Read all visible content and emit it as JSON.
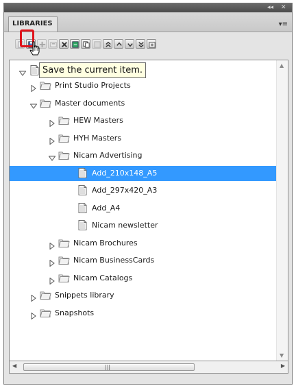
{
  "panel": {
    "tab_label": "LIBRARIES",
    "collapse_label": "◂◂",
    "close_label": "✕",
    "menu_label": "▾≡"
  },
  "toolbar": {
    "buttons": [
      {
        "icon": "document-icon",
        "enabled": false
      },
      {
        "icon": "save-icon",
        "enabled": true
      },
      {
        "icon": "add-icon",
        "enabled": false
      },
      {
        "icon": "properties-icon",
        "enabled": false
      },
      {
        "icon": "delete-icon",
        "enabled": true
      },
      {
        "icon": "move-icon",
        "enabled": true
      },
      {
        "icon": "copy-icon",
        "enabled": true
      },
      {
        "icon": "paste-icon",
        "enabled": false
      },
      {
        "icon": "move-top-icon",
        "enabled": true
      },
      {
        "icon": "move-up-icon",
        "enabled": true
      },
      {
        "icon": "move-down-icon",
        "enabled": true
      },
      {
        "icon": "move-bottom-icon",
        "enabled": true
      },
      {
        "icon": "settings-icon",
        "enabled": true
      }
    ]
  },
  "tooltip": {
    "text": "Save the current item."
  },
  "tree": {
    "items": [
      {
        "label": "Print Studio Projects",
        "level": 1,
        "expanded": false,
        "type": "folder",
        "selected": false
      },
      {
        "label": "Master documents",
        "level": 1,
        "expanded": true,
        "type": "folder",
        "selected": false
      },
      {
        "label": "HEW Masters",
        "level": 2,
        "expanded": false,
        "type": "folder",
        "selected": false
      },
      {
        "label": "HYH Masters",
        "level": 2,
        "expanded": false,
        "type": "folder",
        "selected": false
      },
      {
        "label": "Nicam Advertising",
        "level": 2,
        "expanded": true,
        "type": "folder",
        "selected": false
      },
      {
        "label": "Add_210x148_A5",
        "level": 3,
        "type": "document",
        "selected": true
      },
      {
        "label": "Add_297x420_A3",
        "level": 3,
        "type": "document",
        "selected": false
      },
      {
        "label": "Add_A4",
        "level": 3,
        "type": "document",
        "selected": false
      },
      {
        "label": "Nicam newsletter",
        "level": 3,
        "type": "document",
        "selected": false
      },
      {
        "label": "Nicam Brochures",
        "level": 2,
        "expanded": false,
        "type": "folder",
        "selected": false
      },
      {
        "label": "Nicam BusinessCards",
        "level": 2,
        "expanded": false,
        "type": "folder",
        "selected": false
      },
      {
        "label": "Nicam Catalogs",
        "level": 2,
        "expanded": false,
        "type": "folder",
        "selected": false
      },
      {
        "label": "Snippets library",
        "level": 1,
        "expanded": false,
        "type": "folder",
        "selected": false
      },
      {
        "label": "Snapshots",
        "level": 1,
        "expanded": false,
        "type": "folder",
        "selected": false
      }
    ]
  },
  "colors": {
    "selection": "#3399ff",
    "highlight": "#e0141b",
    "tooltip_bg": "#ffffe1"
  }
}
